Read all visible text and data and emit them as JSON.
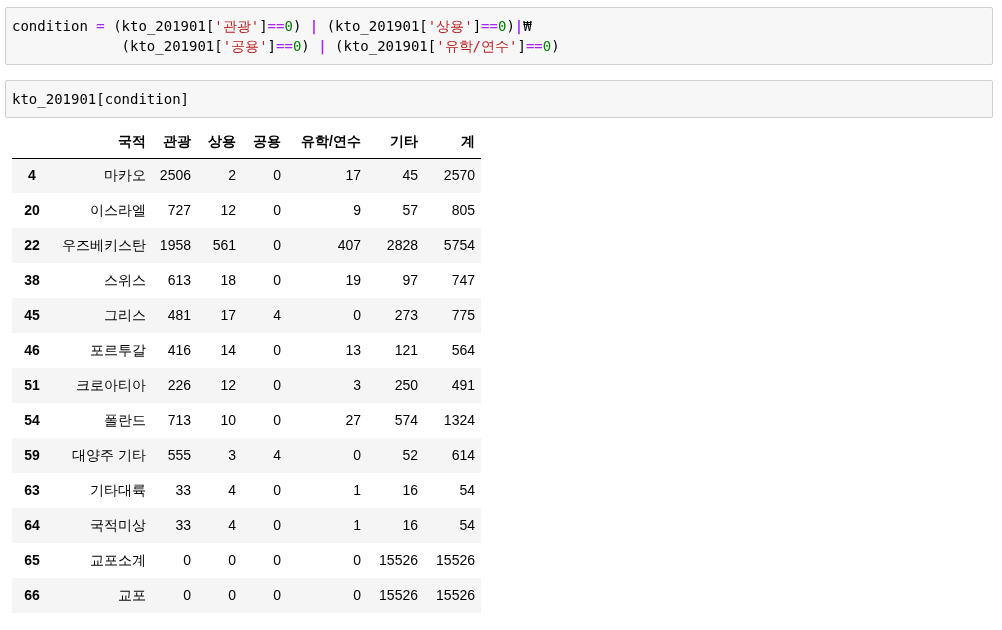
{
  "cells": [
    {
      "lines": [
        [
          {
            "text": "condition ",
            "kind": "plain"
          },
          {
            "text": "=",
            "kind": "op"
          },
          {
            "text": " (kto_201901[",
            "kind": "plain"
          },
          {
            "text": "'관광'",
            "kind": "str"
          },
          {
            "text": "]",
            "kind": "plain"
          },
          {
            "text": "==",
            "kind": "op"
          },
          {
            "text": "0",
            "kind": "num"
          },
          {
            "text": ") ",
            "kind": "plain"
          },
          {
            "text": "|",
            "kind": "bar"
          },
          {
            "text": " (kto_201901[",
            "kind": "plain"
          },
          {
            "text": "'상용'",
            "kind": "str"
          },
          {
            "text": "]",
            "kind": "plain"
          },
          {
            "text": "==",
            "kind": "op"
          },
          {
            "text": "0",
            "kind": "num"
          },
          {
            "text": ")",
            "kind": "plain"
          },
          {
            "text": "|",
            "kind": "bar"
          },
          {
            "text": "₩",
            "kind": "plain"
          }
        ],
        [
          {
            "text": "             (kto_201901[",
            "kind": "plain"
          },
          {
            "text": "'공용'",
            "kind": "str"
          },
          {
            "text": "]",
            "kind": "plain"
          },
          {
            "text": "==",
            "kind": "op"
          },
          {
            "text": "0",
            "kind": "num"
          },
          {
            "text": ") ",
            "kind": "plain"
          },
          {
            "text": "|",
            "kind": "bar"
          },
          {
            "text": " (kto_201901[",
            "kind": "plain"
          },
          {
            "text": "'유학/연수'",
            "kind": "str"
          },
          {
            "text": "]",
            "kind": "plain"
          },
          {
            "text": "==",
            "kind": "op"
          },
          {
            "text": "0",
            "kind": "num"
          },
          {
            "text": ")",
            "kind": "plain"
          }
        ]
      ]
    },
    {
      "lines": [
        [
          {
            "text": "kto_201901[condition]",
            "kind": "plain"
          }
        ]
      ]
    }
  ],
  "table": {
    "columns": [
      "국적",
      "관광",
      "상용",
      "공용",
      "유학/연수",
      "기타",
      "계"
    ],
    "rows": [
      {
        "index": "4",
        "cells": [
          "마카오",
          "2506",
          "2",
          "0",
          "17",
          "45",
          "2570"
        ]
      },
      {
        "index": "20",
        "cells": [
          "이스라엘",
          "727",
          "12",
          "0",
          "9",
          "57",
          "805"
        ]
      },
      {
        "index": "22",
        "cells": [
          "우즈베키스탄",
          "1958",
          "561",
          "0",
          "407",
          "2828",
          "5754"
        ]
      },
      {
        "index": "38",
        "cells": [
          "스위스",
          "613",
          "18",
          "0",
          "19",
          "97",
          "747"
        ]
      },
      {
        "index": "45",
        "cells": [
          "그리스",
          "481",
          "17",
          "4",
          "0",
          "273",
          "775"
        ]
      },
      {
        "index": "46",
        "cells": [
          "포르투갈",
          "416",
          "14",
          "0",
          "13",
          "121",
          "564"
        ]
      },
      {
        "index": "51",
        "cells": [
          "크로아티아",
          "226",
          "12",
          "0",
          "3",
          "250",
          "491"
        ]
      },
      {
        "index": "54",
        "cells": [
          "폴란드",
          "713",
          "10",
          "0",
          "27",
          "574",
          "1324"
        ]
      },
      {
        "index": "59",
        "cells": [
          "대양주 기타",
          "555",
          "3",
          "4",
          "0",
          "52",
          "614"
        ]
      },
      {
        "index": "63",
        "cells": [
          "기타대륙",
          "33",
          "4",
          "0",
          "1",
          "16",
          "54"
        ]
      },
      {
        "index": "64",
        "cells": [
          "국적미상",
          "33",
          "4",
          "0",
          "1",
          "16",
          "54"
        ]
      },
      {
        "index": "65",
        "cells": [
          "교포소계",
          "0",
          "0",
          "0",
          "0",
          "15526",
          "15526"
        ]
      },
      {
        "index": "66",
        "cells": [
          "교포",
          "0",
          "0",
          "0",
          "0",
          "15526",
          "15526"
        ]
      }
    ]
  }
}
